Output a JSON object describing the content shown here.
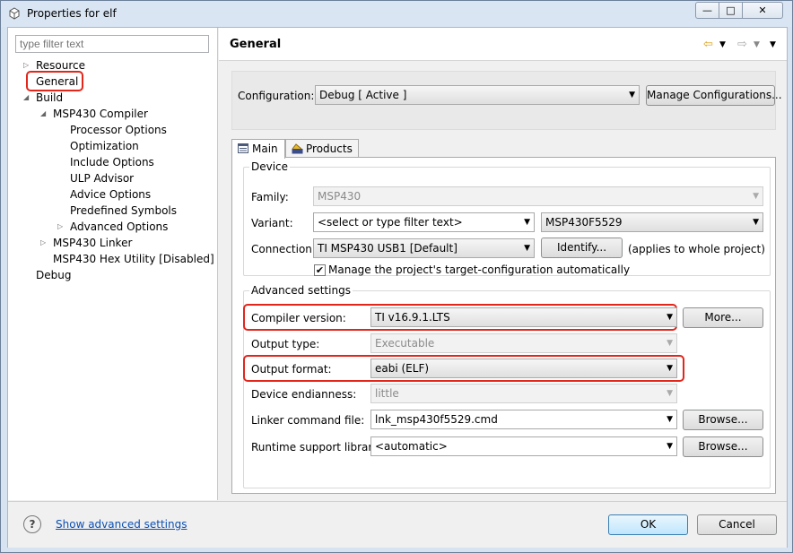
{
  "window": {
    "title": "Properties for elf",
    "controls": {
      "minimize": "—",
      "maximize": "□",
      "close": "✕"
    }
  },
  "sidebar": {
    "filter_placeholder": "type filter text",
    "items": [
      {
        "label": "Resource"
      },
      {
        "label": "General",
        "highlighted": true
      },
      {
        "label": "Build"
      },
      {
        "label": "MSP430 Compiler"
      },
      {
        "label": "Processor Options"
      },
      {
        "label": "Optimization"
      },
      {
        "label": "Include Options"
      },
      {
        "label": "ULP Advisor"
      },
      {
        "label": "Advice Options"
      },
      {
        "label": "Predefined Symbols"
      },
      {
        "label": "Advanced Options"
      },
      {
        "label": "MSP430 Linker"
      },
      {
        "label": "MSP430 Hex Utility  [Disabled]"
      },
      {
        "label": "Debug"
      }
    ]
  },
  "header": {
    "title": "General"
  },
  "configuration": {
    "label": "Configuration:",
    "value": "Debug  [ Active ]",
    "manage_button": "Manage Configurations..."
  },
  "tabs": [
    {
      "label": "Main",
      "active": true
    },
    {
      "label": "Products",
      "active": false
    }
  ],
  "device": {
    "group_title": "Device",
    "family_label": "Family:",
    "family_value": "MSP430",
    "variant_label": "Variant:",
    "variant_filter": "<select or type filter text>",
    "variant_value": "MSP430F5529",
    "connection_label": "Connection:",
    "connection_value": "TI MSP430 USB1 [Default]",
    "identify_button": "Identify...",
    "applies_note": "(applies to whole project)",
    "manage_checkbox_label": "Manage the project's target-configuration automatically",
    "manage_checked": true
  },
  "advanced": {
    "group_title": "Advanced settings",
    "compiler_label": "Compiler version:",
    "compiler_value": "TI v16.9.1.LTS",
    "more_button": "More...",
    "output_type_label": "Output type:",
    "output_type_value": "Executable",
    "output_format_label": "Output format:",
    "output_format_value": "eabi (ELF)",
    "endianness_label": "Device endianness:",
    "endianness_value": "little",
    "linker_label": "Linker command file:",
    "linker_value": "lnk_msp430f5529.cmd",
    "browse_button": "Browse...",
    "runtime_label": "Runtime support library:",
    "runtime_value": "<automatic>"
  },
  "footer": {
    "help_symbol": "?",
    "show_advanced": "Show advanced settings",
    "ok": "OK",
    "cancel": "Cancel"
  },
  "colors": {
    "highlight": "#e1261c",
    "link": "#0b4fb3"
  }
}
